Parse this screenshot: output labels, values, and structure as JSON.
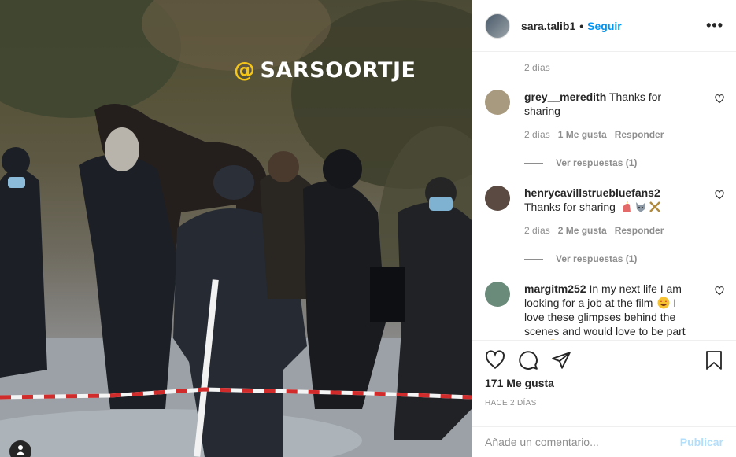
{
  "photo": {
    "watermark_at": "@",
    "watermark_text": "SARSOORTJE"
  },
  "header": {
    "username": "sara.talib1",
    "separator": "•",
    "follow_label": "Seguir",
    "more_label": "•••"
  },
  "caption_age": "2 días",
  "comments": [
    {
      "username": "grey__meredith",
      "text": "Thanks for sharing",
      "age": "2 días",
      "likes": "1 Me gusta",
      "reply_label": "Responder",
      "view_replies": "Ver respuestas (1)",
      "avatar_color": "#a89a7e"
    },
    {
      "username": "henrycavillstruebluefans2",
      "text": "Thanks for sharing",
      "age": "2 días",
      "likes": "2 Me gusta",
      "reply_label": "Responder",
      "view_replies": "Ver respuestas (1)",
      "avatar_color": "#5a4a42",
      "emojis": [
        "unicorn-emoji",
        "wolf-emoji",
        "crossed-swords-emoji"
      ]
    },
    {
      "username": "margitm252",
      "text": "In my next life I am looking for a job at the film",
      "text2": "I love these glimpses behind the scenes and would love to be part of it",
      "avatar_color": "#6a8a7a",
      "emojis": [
        "star-struck-emoji",
        "smiling-emoji"
      ]
    }
  ],
  "actions": {
    "likes": "171 Me gusta",
    "time": "HACE 2 DÍAS"
  },
  "composer": {
    "placeholder": "Añade un comentario...",
    "publish_label": "Publicar"
  },
  "colors": {
    "accent": "#0095f6",
    "publish_disabled": "#b2dffc",
    "muted": "#8e8e8e",
    "text": "#262626"
  }
}
